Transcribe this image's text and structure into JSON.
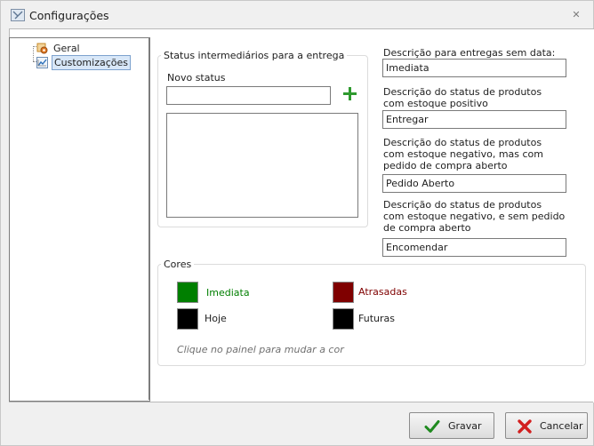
{
  "window": {
    "title": "Configurações",
    "close_icon": "close-icon"
  },
  "tree": {
    "items": [
      {
        "label": "Geral",
        "icon": "settings-gear-icon"
      },
      {
        "label": "Customizações",
        "icon": "customize-icon",
        "selected": true
      }
    ]
  },
  "status_group": {
    "title": "Status intermediários para a entrega",
    "new_status_label": "Novo status",
    "new_status_value": "",
    "add_icon": "plus-icon",
    "items": []
  },
  "descriptions": {
    "no_date": {
      "label": "Descrição para entregas sem data:",
      "value": "Imediata"
    },
    "positive_stock": {
      "label": "Descrição do status de produtos com estoque positivo",
      "value": "Entregar"
    },
    "negative_with_po": {
      "label": "Descrição do status de produtos com estoque negativo, mas com pedido de compra aberto",
      "value": "Pedido Aberto"
    },
    "negative_without_po": {
      "label": "Descrição do status de produtos com estoque negativo, e sem pedido de compra aberto",
      "value": "Encomendar"
    }
  },
  "colors_group": {
    "title": "Cores",
    "items": {
      "imediata": {
        "label": "Imediata",
        "color": "#007f00"
      },
      "atrasadas": {
        "label": "Atrasadas",
        "color": "#7f0000"
      },
      "hoje": {
        "label": "Hoje",
        "color": "#000000"
      },
      "futuras": {
        "label": "Futuras",
        "color": "#000000"
      }
    },
    "hint": "Clique no painel para mudar a cor"
  },
  "buttons": {
    "save": {
      "label": "Gravar",
      "icon": "checkmark-icon",
      "icon_color": "#1f8a1f"
    },
    "cancel": {
      "label": "Cancelar",
      "icon": "x-icon",
      "icon_color": "#d21f1f"
    }
  }
}
